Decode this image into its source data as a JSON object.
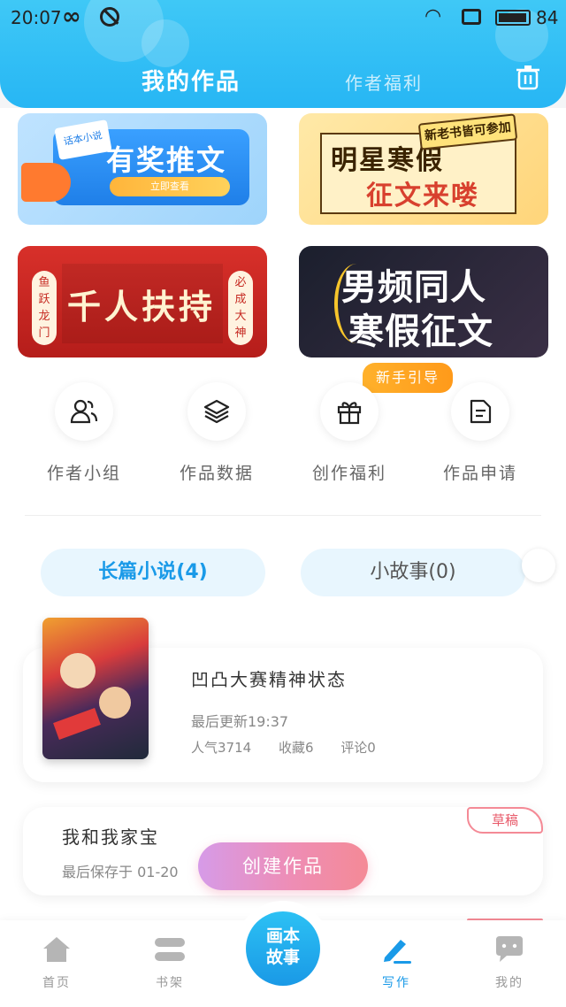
{
  "status_bar": {
    "time": "20:07",
    "battery": "84"
  },
  "header": {
    "tab_my_works": "我的作品",
    "tab_author_benefits": "作者福利"
  },
  "banners": {
    "b1": {
      "note": "话本小说",
      "title": "有奖推文",
      "button": "立即查看"
    },
    "b2": {
      "tag": "新老书皆可参加",
      "line1": "明星寒假",
      "line2": "征文来喽"
    },
    "b3": {
      "title": "千人扶持",
      "left_side": "鱼跃龙门",
      "right_side": "必成大神"
    },
    "b4": {
      "line1": "男频同人",
      "line2": "寒假征文"
    }
  },
  "guide_badge": "新手引导",
  "quick_actions": [
    {
      "label": "作者小组"
    },
    {
      "label": "作品数据"
    },
    {
      "label": "创作福利"
    },
    {
      "label": "作品申请"
    }
  ],
  "type_tabs": {
    "long": "长篇小说(4)",
    "short": "小故事(0)"
  },
  "works": [
    {
      "title": "凹凸大赛精神状态",
      "update": "最后更新19:37",
      "popularity": "人气3714",
      "favorites": "收藏6",
      "comments": "评论0"
    },
    {
      "title": "我和我家宝",
      "saved": "最后保存于 01-20",
      "badge": "草稿"
    }
  ],
  "create_button": "创建作品",
  "bottom_nav": {
    "home": "首页",
    "shelf": "书架",
    "center_line1": "画本",
    "center_line2": "故事",
    "write": "写作",
    "me": "我的"
  },
  "colors": {
    "accent": "#1a9ae8",
    "header": "#27b6f4",
    "draft": "#e85a6a"
  }
}
